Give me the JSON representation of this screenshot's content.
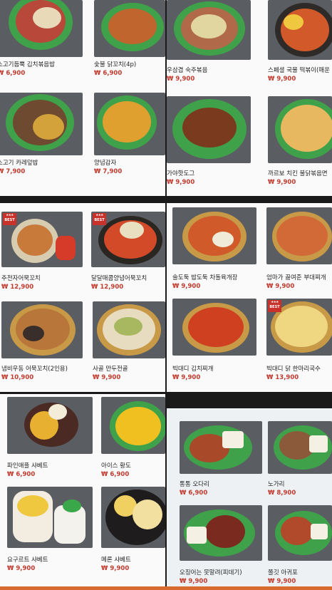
{
  "currency": "₩",
  "badge": {
    "stars": "★★★",
    "label": "BEST"
  },
  "panels": [
    {
      "id": "panel-1",
      "items": [
        {
          "name": "소고기듬뿍 김치볶음밥",
          "price": "6,900"
        },
        {
          "name": "숯불 닭꼬치(4p)",
          "price": "6,900"
        },
        {
          "name": "소고기 카레덮밥",
          "price": "7,900"
        },
        {
          "name": "양념감자",
          "price": "7,900"
        }
      ]
    },
    {
      "id": "panel-2",
      "items": [
        {
          "name": "우삼겹 숙주볶음",
          "price": "9,900"
        },
        {
          "name": "스페셜 국물 떡볶이(매운",
          "price": "9,900"
        },
        {
          "name": "가야핫도그",
          "price": "9,900"
        },
        {
          "name": "까르보 치킨 불닭볶음면",
          "price": "9,900"
        }
      ]
    },
    {
      "id": "panel-3",
      "items": [
        {
          "name": "주전자어묵꼬치",
          "price": "12,900",
          "best": true
        },
        {
          "name": "달달매콤양념어묵꼬치",
          "price": "12,900",
          "best": true
        },
        {
          "name": "냄비우동 어묵꼬치(2인용)",
          "price": "10,900"
        },
        {
          "name": "사골 만두전골",
          "price": "9,900"
        }
      ]
    },
    {
      "id": "panel-4",
      "items": [
        {
          "name": "술도둑 밥도둑 차돌육개장",
          "price": "9,900"
        },
        {
          "name": "엄마가 끓여준 부대찌개",
          "price": "9,900"
        },
        {
          "name": "빅대디 김치찌개",
          "price": "9,900"
        },
        {
          "name": "빅대디 닭 한마리국수",
          "price": "13,900",
          "best": true
        }
      ]
    },
    {
      "id": "panel-5",
      "items": [
        {
          "name": "파인애플 샤베트",
          "price": "6,900"
        },
        {
          "name": "아이스 황도",
          "price": "6,900"
        },
        {
          "name": "요구르트 샤베트",
          "price": "9,900"
        },
        {
          "name": "메론 샤베트",
          "price": "9,900"
        }
      ]
    },
    {
      "id": "panel-6",
      "items": [
        {
          "name": "통통 오다리",
          "price": "6,900"
        },
        {
          "name": "노가리",
          "price": "8,900"
        },
        {
          "name": "오징어는 못말려(피데기)",
          "price": "9,900"
        },
        {
          "name": "쫄깃 아귀포",
          "price": "9,900"
        }
      ]
    }
  ]
}
